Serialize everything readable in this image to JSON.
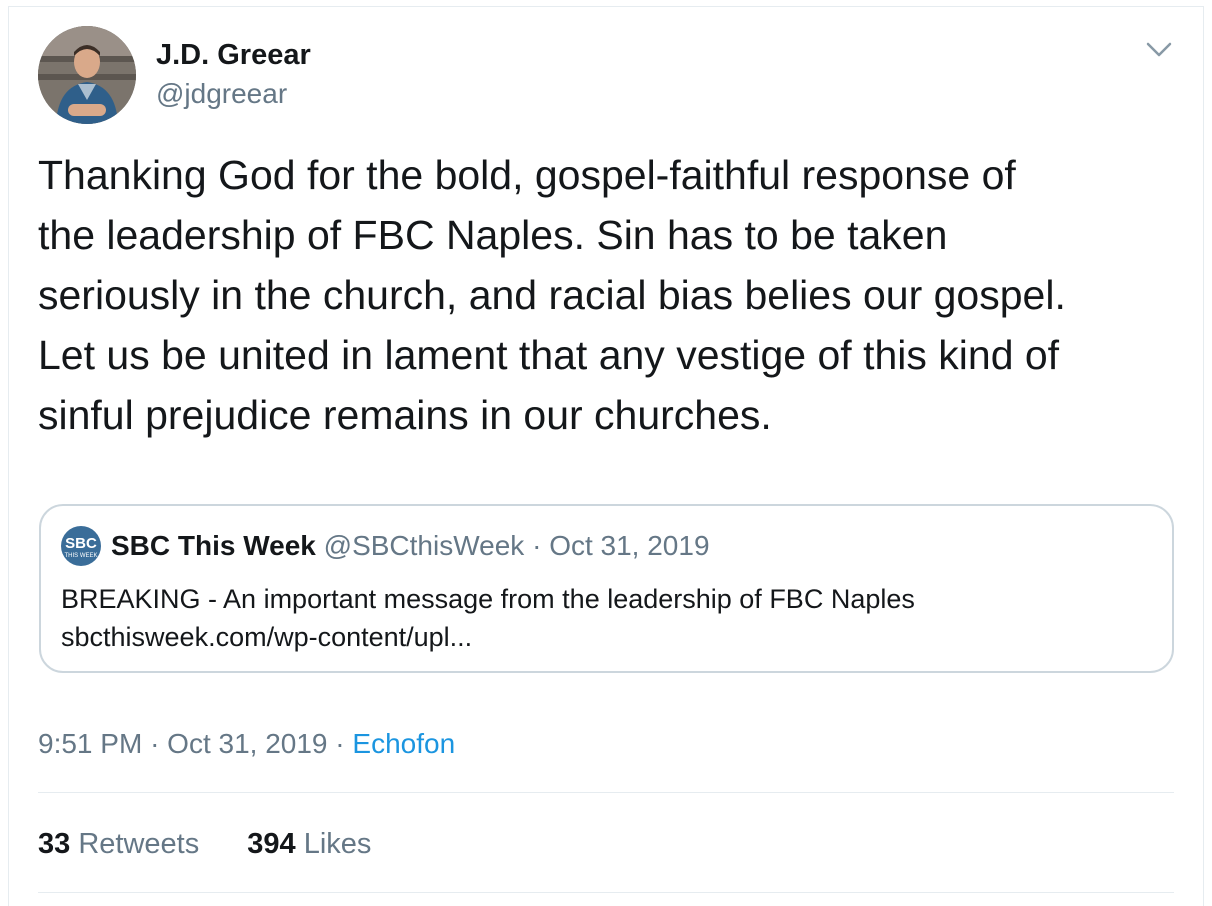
{
  "author": {
    "name": "J.D. Greear",
    "handle": "@jdgreear"
  },
  "tweet": {
    "text": "Thanking God for the bold, gospel-faithful response of\nthe leadership of FBC Naples. Sin has to be taken\nseriously in the church, and racial bias belies our gospel.\nLet us be united in lament that any vestige of this kind of\nsinful prejudice remains in our churches."
  },
  "quoted_tweet": {
    "logo_text": "SBC",
    "logo_subtext": "THIS WEEK",
    "name": "SBC This Week",
    "handle": "@SBCthisWeek",
    "separator": "·",
    "date": "Oct 31, 2019",
    "line1": "BREAKING - An important message from the leadership of FBC Naples",
    "line2": "sbcthisweek.com/wp-content/upl..."
  },
  "meta": {
    "time": "9:51 PM",
    "sep1": "·",
    "date": "Oct 31, 2019",
    "sep2": "·",
    "source": "Echofon"
  },
  "stats": {
    "retweets_count": "33",
    "retweets_label": "Retweets",
    "likes_count": "394",
    "likes_label": "Likes"
  },
  "icons": {
    "menu": "chevron-down-icon",
    "avatar": "avatar"
  },
  "colors": {
    "link": "#1b95e0",
    "secondary_text": "#657786",
    "border": "#ccd6dd"
  }
}
